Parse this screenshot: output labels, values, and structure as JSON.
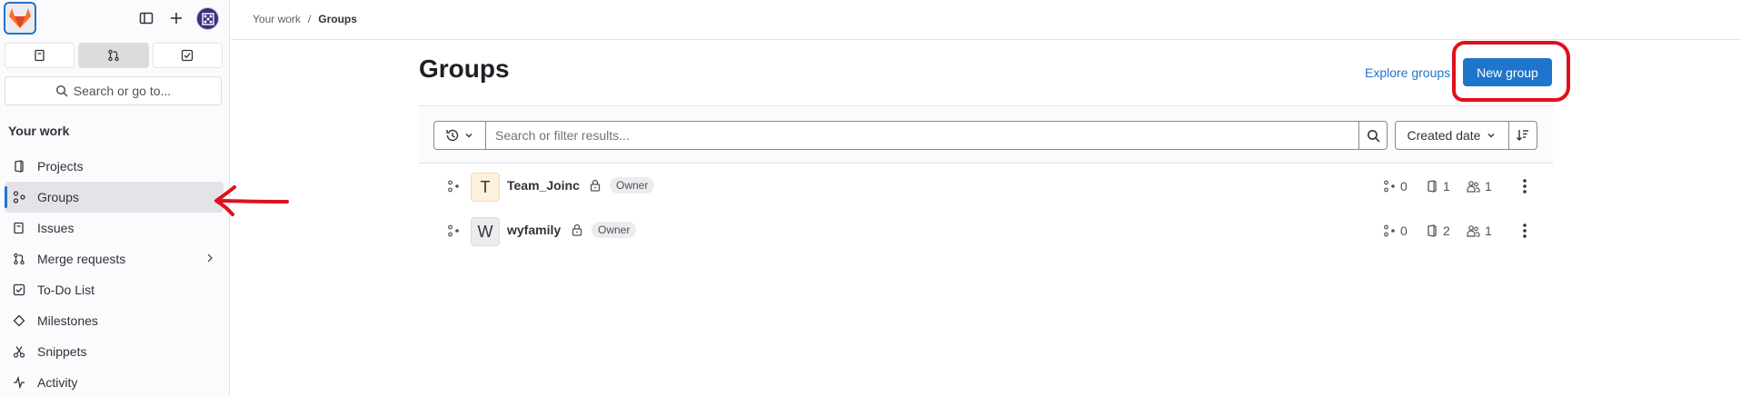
{
  "sidebar": {
    "search_placeholder": "Search or go to...",
    "section_title": "Your work",
    "items": [
      {
        "label": "Projects",
        "icon": "project-icon"
      },
      {
        "label": "Groups",
        "icon": "group-icon",
        "active": true
      },
      {
        "label": "Issues",
        "icon": "issues-icon"
      },
      {
        "label": "Merge requests",
        "icon": "merge-request-icon",
        "has_submenu": true
      },
      {
        "label": "To-Do List",
        "icon": "todo-icon"
      },
      {
        "label": "Milestones",
        "icon": "milestone-icon"
      },
      {
        "label": "Snippets",
        "icon": "snippet-icon"
      },
      {
        "label": "Activity",
        "icon": "activity-icon"
      }
    ]
  },
  "breadcrumb": {
    "root": "Your work",
    "separator": "/",
    "current": "Groups"
  },
  "page": {
    "title": "Groups",
    "explore_label": "Explore groups",
    "new_group_label": "New group"
  },
  "filter": {
    "placeholder": "Search or filter results...",
    "sort_label": "Created date"
  },
  "groups": [
    {
      "initial": "T",
      "name": "Team_Joinc",
      "visibility": "private",
      "role": "Owner",
      "subgroups": "0",
      "projects": "1",
      "members": "1",
      "avatar_bg": "#fdf1dd"
    },
    {
      "initial": "W",
      "name": "wyfamily",
      "visibility": "private",
      "role": "Owner",
      "subgroups": "0",
      "projects": "2",
      "members": "1",
      "avatar_bg": "#ececef"
    }
  ],
  "colors": {
    "accent": "#1f75cb",
    "annotation": "#e0101c"
  }
}
